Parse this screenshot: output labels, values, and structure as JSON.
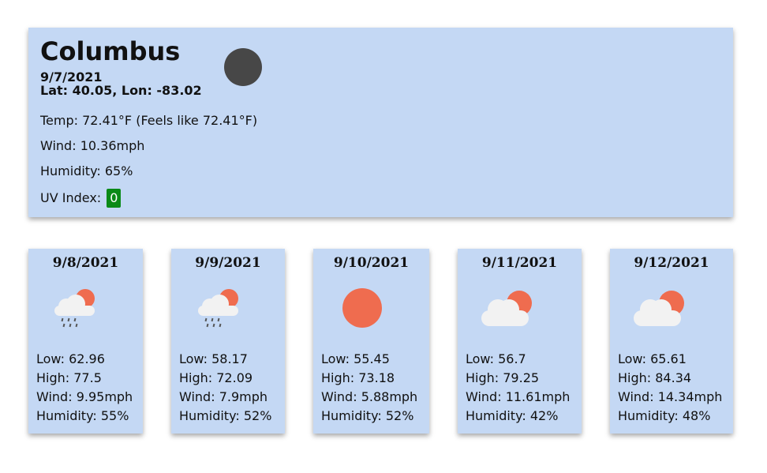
{
  "current": {
    "city": "Columbus",
    "date": "9/7/2021",
    "latlon": "Lat: 40.05, Lon: -83.02",
    "temp": "Temp: 72.41°F (Feels like 72.41°F)",
    "wind": "Wind: 10.36mph",
    "humidity": "Humidity: 65%",
    "uv_label": "UV Index:",
    "uv_value": "0",
    "icon": "moon-icon"
  },
  "forecast": [
    {
      "date": "9/8/2021",
      "icon": "rain-cloud-sun-icon",
      "low": "Low: 62.96",
      "high": "High: 77.5",
      "wind": "Wind: 9.95mph",
      "humidity": "Humidity: 55%"
    },
    {
      "date": "9/9/2021",
      "icon": "rain-cloud-sun-icon",
      "low": "Low: 58.17",
      "high": "High: 72.09",
      "wind": "Wind: 7.9mph",
      "humidity": "Humidity: 52%"
    },
    {
      "date": "9/10/2021",
      "icon": "sun-icon",
      "low": "Low: 55.45",
      "high": "High: 73.18",
      "wind": "Wind: 5.88mph",
      "humidity": "Humidity: 52%"
    },
    {
      "date": "9/11/2021",
      "icon": "cloud-sun-icon",
      "low": "Low: 56.7",
      "high": "High: 79.25",
      "wind": "Wind: 11.61mph",
      "humidity": "Humidity: 42%"
    },
    {
      "date": "9/12/2021",
      "icon": "cloud-sun-icon",
      "low": "Low: 65.61",
      "high": "High: 84.34",
      "wind": "Wind: 14.34mph",
      "humidity": "Humidity: 48%"
    }
  ],
  "colors": {
    "card_bg": "#c4d8f4",
    "uv_badge": "#0a8a17",
    "sun": "#ef6c4f",
    "moon": "#474747"
  }
}
